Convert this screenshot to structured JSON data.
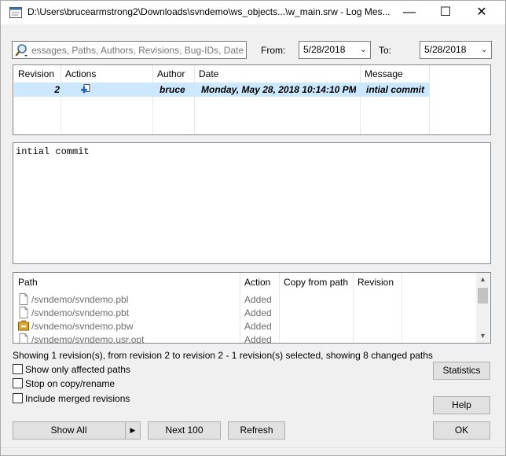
{
  "window": {
    "title": "D:\\Users\\brucearmstrong2\\Downloads\\svndemo\\ws_objects...\\w_main.srw - Log Mes...",
    "minimize_glyph": "—",
    "maximize_glyph": "☐",
    "close_glyph": "✕"
  },
  "filter": {
    "search_placeholder": "essages, Paths, Authors, Revisions, Bug-IDs, Date,",
    "from_label": "From:",
    "from_value": "5/28/2018",
    "to_label": "To:",
    "to_value": "5/28/2018"
  },
  "revisions": {
    "columns": [
      "Revision",
      "Actions",
      "Author",
      "Date",
      "Message"
    ],
    "rows": [
      {
        "revision": "2",
        "author": "bruce",
        "date": "Monday, May 28, 2018 10:14:10 PM",
        "message": "intial commit"
      }
    ]
  },
  "message_text": "intial commit",
  "paths": {
    "columns": [
      "Path",
      "Action",
      "Copy from path",
      "Revision"
    ],
    "rows": [
      {
        "path": "/svndemo/svndemo.pbl",
        "action": "Added",
        "icon": "file-icon"
      },
      {
        "path": "/svndemo/svndemo.pbt",
        "action": "Added",
        "icon": "file-icon"
      },
      {
        "path": "/svndemo/svndemo.pbw",
        "action": "Added",
        "icon": "workspace-icon"
      },
      {
        "path": "/svndemo/svndemo.usr.opt",
        "action": "Added",
        "icon": "file-icon"
      }
    ]
  },
  "status_text": "Showing 1 revision(s), from revision 2 to revision 2 - 1 revision(s) selected, showing 8 changed paths",
  "options": {
    "show_affected": "Show only affected paths",
    "stop_on_copy": "Stop on copy/rename",
    "include_merged": "Include merged revisions"
  },
  "buttons": {
    "statistics": "Statistics",
    "help": "Help",
    "show_all": "Show All",
    "next_100": "Next 100",
    "refresh": "Refresh",
    "ok": "OK"
  },
  "colors": {
    "selection": "#cce8ff",
    "window_bg": "#f0f0f0"
  }
}
